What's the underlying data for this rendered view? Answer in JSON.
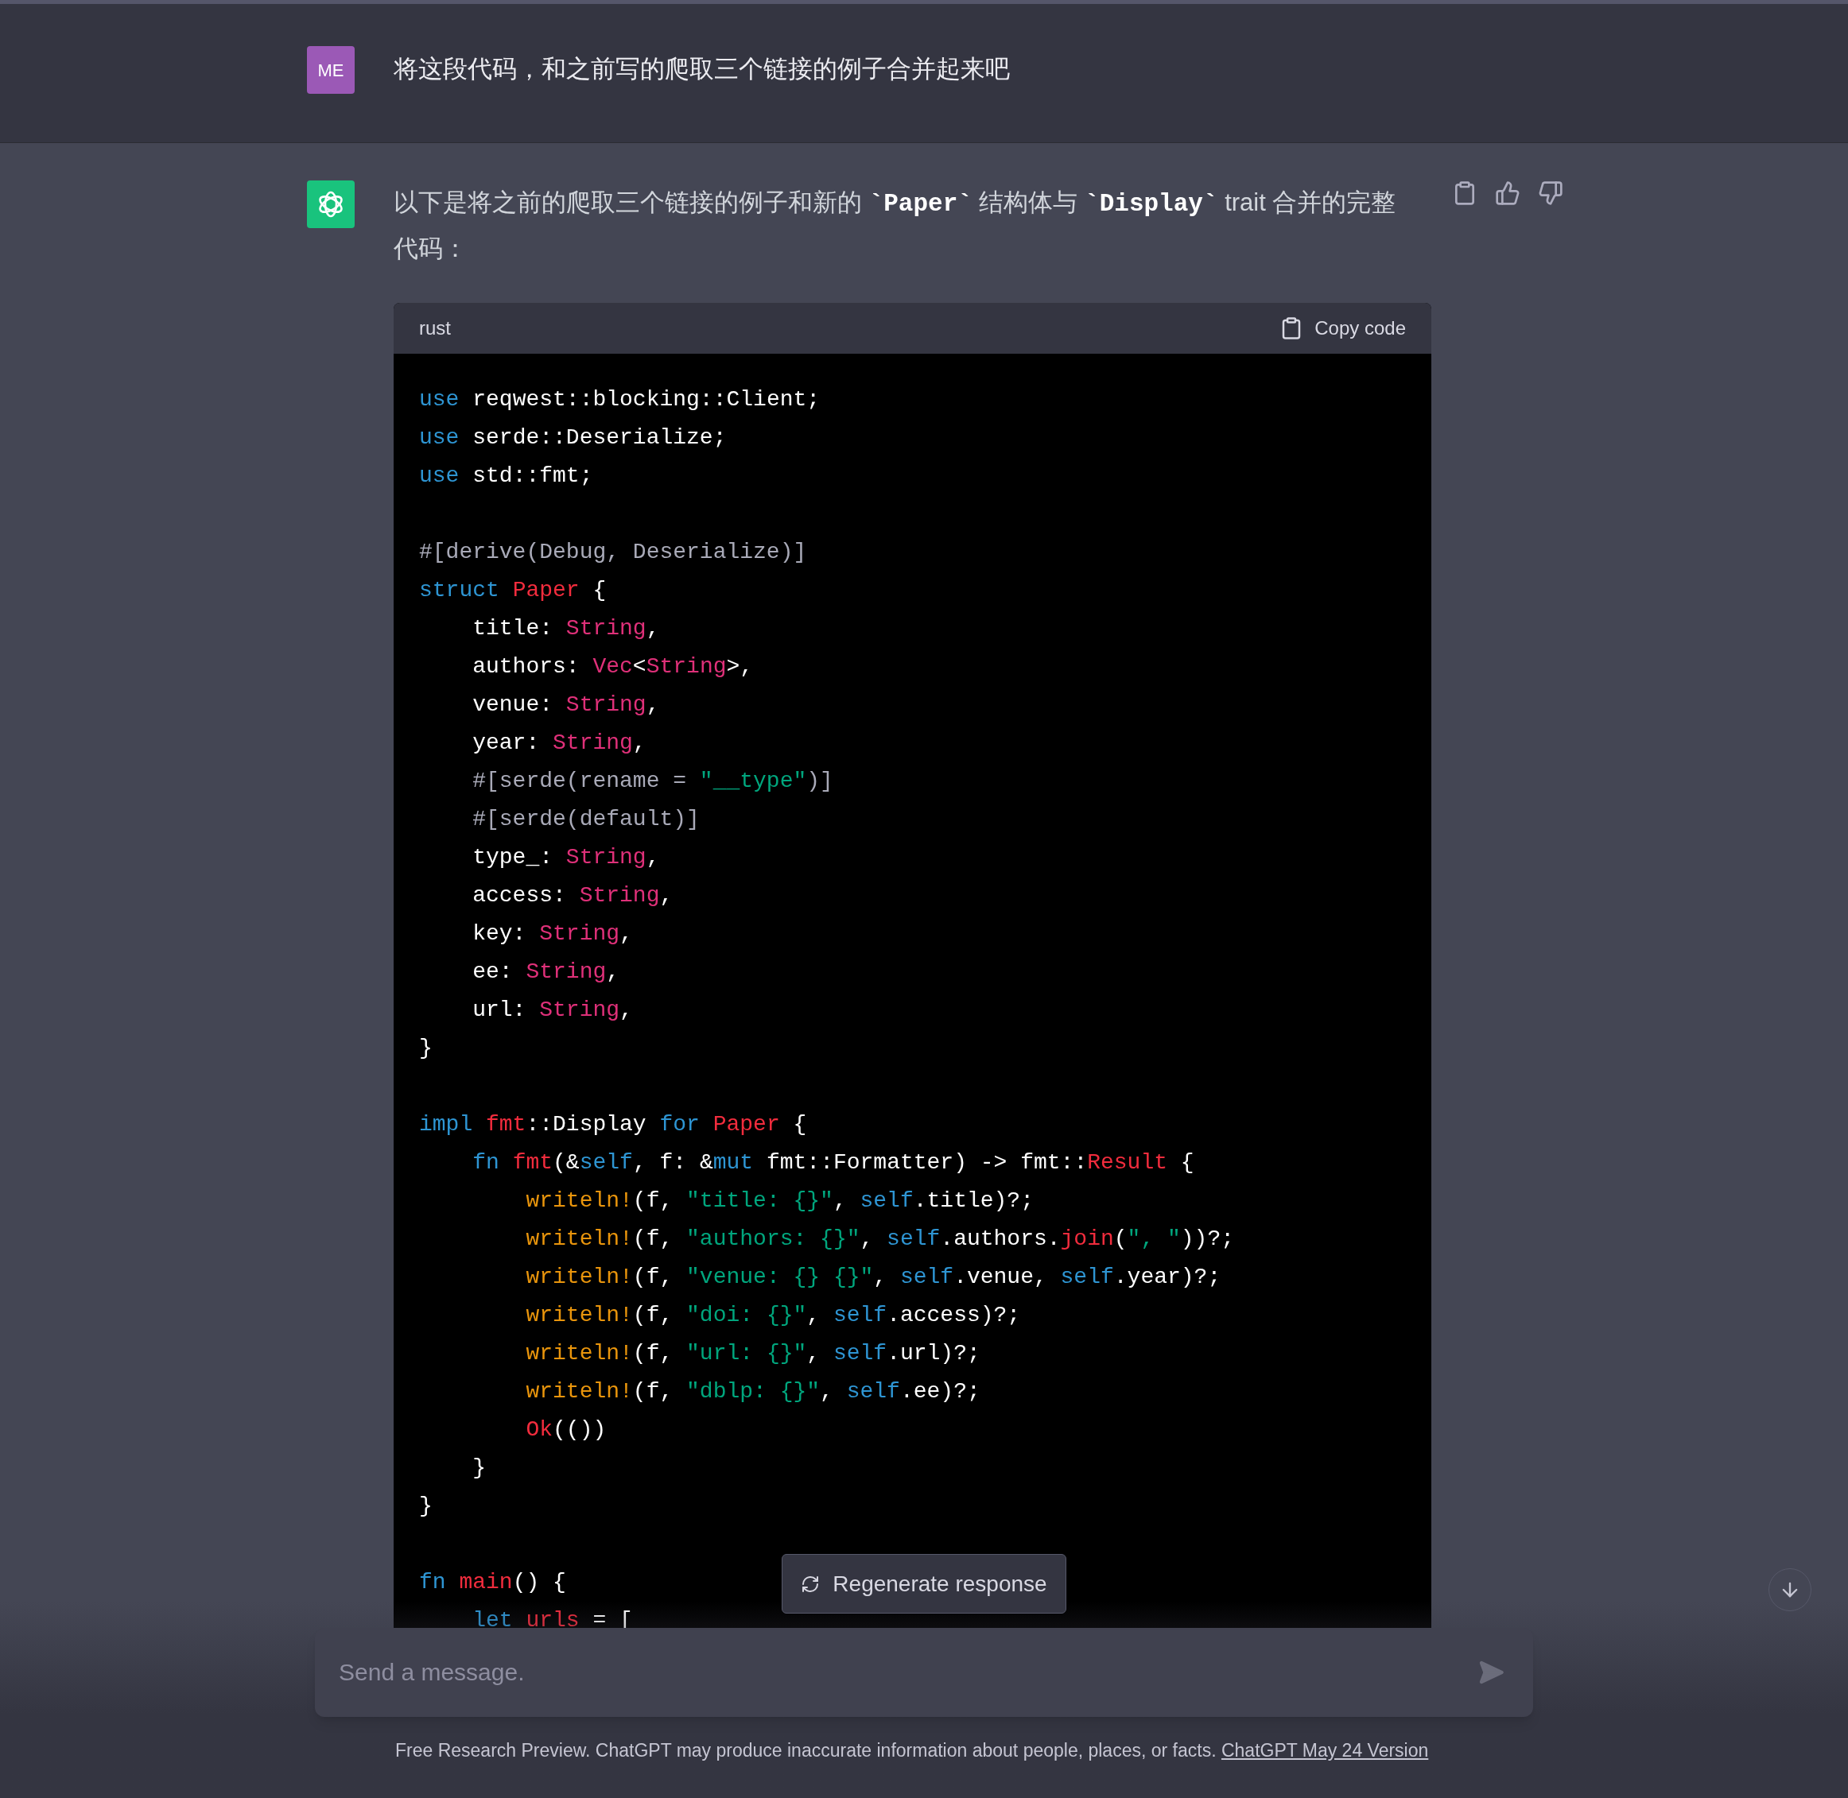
{
  "user_message": {
    "avatar": "ME",
    "text": "将这段代码，和之前写的爬取三个链接的例子合并起来吧"
  },
  "assistant_message": {
    "text": "以下是将之前的爬取三个链接的例子和新的 **`Paper`** 结构体与 **`Display`** trait 合并的完整代码：",
    "code_block": {
      "language": "rust",
      "copy_label": "Copy code",
      "lines": [
        {
          "kind": "code",
          "tokens": [
            {
              "t": "use",
              "kind": "keyword"
            },
            {
              "t": " reqwest::blocking::Client;",
              "kind": "plain"
            }
          ]
        },
        {
          "kind": "code",
          "tokens": [
            {
              "t": "use",
              "kind": "keyword"
            },
            {
              "t": " serde::Deserialize;",
              "kind": "plain"
            }
          ]
        },
        {
          "kind": "code",
          "tokens": [
            {
              "t": "use",
              "kind": "keyword"
            },
            {
              "t": " std::fmt;",
              "kind": "plain"
            }
          ]
        },
        {
          "kind": "blank"
        },
        {
          "kind": "code",
          "tokens": [
            {
              "t": "#[derive(Debug, Deserialize)]",
              "kind": "attr"
            }
          ]
        },
        {
          "kind": "code",
          "tokens": [
            {
              "t": "struct ",
              "kind": "keyword"
            },
            {
              "t": "Paper",
              "kind": "func"
            },
            {
              "t": " {",
              "kind": "plain"
            }
          ]
        },
        {
          "kind": "code",
          "tokens": [
            {
              "t": "    title: ",
              "kind": "plain"
            },
            {
              "t": "String",
              "kind": "type"
            },
            {
              "t": ",",
              "kind": "plain"
            }
          ]
        },
        {
          "kind": "code",
          "tokens": [
            {
              "t": "    authors: ",
              "kind": "plain"
            },
            {
              "t": "Vec",
              "kind": "type"
            },
            {
              "t": "<",
              "kind": "plain"
            },
            {
              "t": "String",
              "kind": "type"
            },
            {
              "t": ">,",
              "kind": "plain"
            }
          ]
        },
        {
          "kind": "code",
          "tokens": [
            {
              "t": "    venue: ",
              "kind": "plain"
            },
            {
              "t": "String",
              "kind": "type"
            },
            {
              "t": ",",
              "kind": "plain"
            }
          ]
        },
        {
          "kind": "code",
          "tokens": [
            {
              "t": "    year: ",
              "kind": "plain"
            },
            {
              "t": "String",
              "kind": "type"
            },
            {
              "t": ",",
              "kind": "plain"
            }
          ]
        },
        {
          "kind": "code",
          "tokens": [
            {
              "t": "    #[serde(rename = ",
              "kind": "attr"
            },
            {
              "t": "\"__type\"",
              "kind": "string"
            },
            {
              "t": ")]",
              "kind": "attr"
            }
          ]
        },
        {
          "kind": "code",
          "tokens": [
            {
              "t": "    #[serde(default)]",
              "kind": "attr"
            }
          ]
        },
        {
          "kind": "code",
          "tokens": [
            {
              "t": "    type_: ",
              "kind": "plain"
            },
            {
              "t": "String",
              "kind": "type"
            },
            {
              "t": ",",
              "kind": "plain"
            }
          ]
        },
        {
          "kind": "code",
          "tokens": [
            {
              "t": "    access: ",
              "kind": "plain"
            },
            {
              "t": "String",
              "kind": "type"
            },
            {
              "t": ",",
              "kind": "plain"
            }
          ]
        },
        {
          "kind": "code",
          "tokens": [
            {
              "t": "    key: ",
              "kind": "plain"
            },
            {
              "t": "String",
              "kind": "type"
            },
            {
              "t": ",",
              "kind": "plain"
            }
          ]
        },
        {
          "kind": "code",
          "tokens": [
            {
              "t": "    ee: ",
              "kind": "plain"
            },
            {
              "t": "String",
              "kind": "type"
            },
            {
              "t": ",",
              "kind": "plain"
            }
          ]
        },
        {
          "kind": "code",
          "tokens": [
            {
              "t": "    url: ",
              "kind": "plain"
            },
            {
              "t": "String",
              "kind": "type"
            },
            {
              "t": ",",
              "kind": "plain"
            }
          ]
        },
        {
          "kind": "code",
          "tokens": [
            {
              "t": "}",
              "kind": "plain"
            }
          ]
        },
        {
          "kind": "blank"
        },
        {
          "kind": "code",
          "tokens": [
            {
              "t": "impl ",
              "kind": "keyword"
            },
            {
              "t": "fmt",
              "kind": "func"
            },
            {
              "t": "::Display ",
              "kind": "plain"
            },
            {
              "t": "for ",
              "kind": "keyword"
            },
            {
              "t": "Paper",
              "kind": "func"
            },
            {
              "t": " {",
              "kind": "plain"
            }
          ]
        },
        {
          "kind": "code",
          "tokens": [
            {
              "t": "    fn ",
              "kind": "keyword"
            },
            {
              "t": "fmt",
              "kind": "func"
            },
            {
              "t": "(&",
              "kind": "plain"
            },
            {
              "t": "self",
              "kind": "keyword"
            },
            {
              "t": ", f: &",
              "kind": "plain"
            },
            {
              "t": "mut",
              "kind": "keyword"
            },
            {
              "t": " fmt::Formatter) -> fmt::",
              "kind": "plain"
            },
            {
              "t": "Result",
              "kind": "func"
            },
            {
              "t": " {",
              "kind": "plain"
            }
          ]
        },
        {
          "kind": "code",
          "tokens": [
            {
              "t": "        writeln!",
              "kind": "macro"
            },
            {
              "t": "(f, ",
              "kind": "plain"
            },
            {
              "t": "\"title: {}\"",
              "kind": "string"
            },
            {
              "t": ", ",
              "kind": "plain"
            },
            {
              "t": "self",
              "kind": "keyword"
            },
            {
              "t": ".title)?;",
              "kind": "plain"
            }
          ]
        },
        {
          "kind": "code",
          "tokens": [
            {
              "t": "        writeln!",
              "kind": "macro"
            },
            {
              "t": "(f, ",
              "kind": "plain"
            },
            {
              "t": "\"authors: {}\"",
              "kind": "string"
            },
            {
              "t": ", ",
              "kind": "plain"
            },
            {
              "t": "self",
              "kind": "keyword"
            },
            {
              "t": ".authors.",
              "kind": "plain"
            },
            {
              "t": "join",
              "kind": "func"
            },
            {
              "t": "(",
              "kind": "plain"
            },
            {
              "t": "\", \"",
              "kind": "string"
            },
            {
              "t": "))?;",
              "kind": "plain"
            }
          ]
        },
        {
          "kind": "code",
          "tokens": [
            {
              "t": "        writeln!",
              "kind": "macro"
            },
            {
              "t": "(f, ",
              "kind": "plain"
            },
            {
              "t": "\"venue: {} {}\"",
              "kind": "string"
            },
            {
              "t": ", ",
              "kind": "plain"
            },
            {
              "t": "self",
              "kind": "keyword"
            },
            {
              "t": ".venue, ",
              "kind": "plain"
            },
            {
              "t": "self",
              "kind": "keyword"
            },
            {
              "t": ".year)?;",
              "kind": "plain"
            }
          ]
        },
        {
          "kind": "code",
          "tokens": [
            {
              "t": "        writeln!",
              "kind": "macro"
            },
            {
              "t": "(f, ",
              "kind": "plain"
            },
            {
              "t": "\"doi: {}\"",
              "kind": "string"
            },
            {
              "t": ", ",
              "kind": "plain"
            },
            {
              "t": "self",
              "kind": "keyword"
            },
            {
              "t": ".access)?;",
              "kind": "plain"
            }
          ]
        },
        {
          "kind": "code",
          "tokens": [
            {
              "t": "        writeln!",
              "kind": "macro"
            },
            {
              "t": "(f, ",
              "kind": "plain"
            },
            {
              "t": "\"url: {}\"",
              "kind": "string"
            },
            {
              "t": ", ",
              "kind": "plain"
            },
            {
              "t": "self",
              "kind": "keyword"
            },
            {
              "t": ".url)?;",
              "kind": "plain"
            }
          ]
        },
        {
          "kind": "code",
          "tokens": [
            {
              "t": "        writeln!",
              "kind": "macro"
            },
            {
              "t": "(f, ",
              "kind": "plain"
            },
            {
              "t": "\"dblp: {}\"",
              "kind": "string"
            },
            {
              "t": ", ",
              "kind": "plain"
            },
            {
              "t": "self",
              "kind": "keyword"
            },
            {
              "t": ".ee)?;",
              "kind": "plain"
            }
          ]
        },
        {
          "kind": "code",
          "tokens": [
            {
              "t": "        Ok",
              "kind": "func"
            },
            {
              "t": "(())",
              "kind": "plain"
            }
          ]
        },
        {
          "kind": "code",
          "tokens": [
            {
              "t": "    }",
              "kind": "plain"
            }
          ]
        },
        {
          "kind": "code",
          "tokens": [
            {
              "t": "}",
              "kind": "plain"
            }
          ]
        },
        {
          "kind": "blank"
        },
        {
          "kind": "code",
          "tokens": [
            {
              "t": "fn ",
              "kind": "keyword"
            },
            {
              "t": "main",
              "kind": "func"
            },
            {
              "t": "() {",
              "kind": "plain"
            }
          ]
        },
        {
          "kind": "code",
          "tokens": [
            {
              "t": "    let ",
              "kind": "keyword"
            },
            {
              "t": "urls",
              "kind": "func"
            },
            {
              "t": " = [",
              "kind": "plain"
            }
          ]
        }
      ]
    }
  },
  "regenerate_button": "Regenerate response",
  "composer": {
    "placeholder": "Send a message."
  },
  "footer": {
    "text": "Free Research Preview. ChatGPT may produce inaccurate information about people, places, or facts. ",
    "link": "ChatGPT May 24 Version"
  }
}
